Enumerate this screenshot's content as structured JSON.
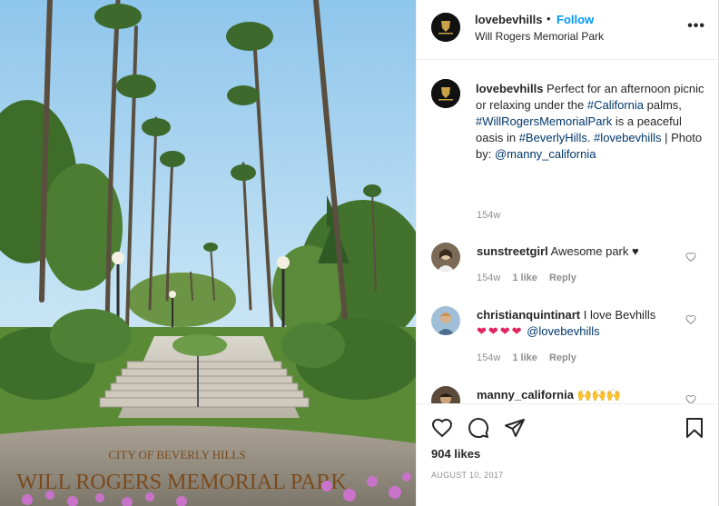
{
  "post": {
    "username": "lovebevhills",
    "separator": "•",
    "follow_label": "Follow",
    "location": "Will Rogers Memorial Park",
    "more_label": "•••"
  },
  "photo": {
    "sign_line1": "CITY OF BEVERLY HILLS",
    "sign_line2": "WILL ROGERS MEMORIAL PARK"
  },
  "caption": {
    "username": "lovebevhills",
    "text1": " Perfect for an afternoon picnic or relaxing under the ",
    "tag1": "#California",
    "text2": " palms, ",
    "tag2": "#WillRogersMemorialPark",
    "text3": " is a peaceful oasis in ",
    "tag3": "#BeverlyHills",
    "text4": ". ",
    "tag4": "#lovebevhills",
    "text5": " | Photo by: ",
    "tag5": "@manny_california",
    "time": "154w"
  },
  "comments": [
    {
      "username": "sunstreetgirl",
      "text": " Awesome park ♥",
      "time": "154w",
      "likes": "1 like",
      "reply": "Reply"
    },
    {
      "username": "christianquintinart",
      "text": " I love Bevhills",
      "emoji": "❤❤❤❤",
      "mention": "@lovebevhills",
      "time": "154w",
      "likes": "1 like",
      "reply": "Reply"
    },
    {
      "username": "manny_california",
      "text": " ",
      "emoji": "🙌🙌🙌"
    }
  ],
  "actions": {
    "likes": "904 likes",
    "date": "AUGUST 10, 2017"
  },
  "colors": {
    "link": "#0095f6",
    "hashtag": "#00376b",
    "muted": "#8e8e8e",
    "text": "#262626"
  }
}
